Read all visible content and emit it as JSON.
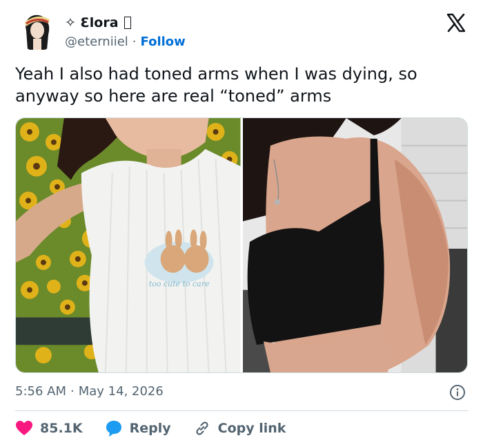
{
  "author": {
    "display_name": "✧ Ɛlora",
    "handle": "@eterniiel",
    "separator": "·",
    "follow_label": "Follow"
  },
  "tweet": {
    "text": "Yeah I also had toned arms when I was dying, so anyway so here are real “toned” arms"
  },
  "media": {
    "shirt_print_text": "too cute to care"
  },
  "meta": {
    "time": "5:56 AM",
    "separator": "·",
    "date": "May 14, 2026"
  },
  "actions": {
    "likes": "85.1K",
    "reply_label": "Reply",
    "copy_label": "Copy link"
  },
  "colors": {
    "accent": "#006fd6",
    "heart": "#f91880",
    "reply_bubble": "#1d9bf0",
    "secondary_text": "#536471"
  }
}
